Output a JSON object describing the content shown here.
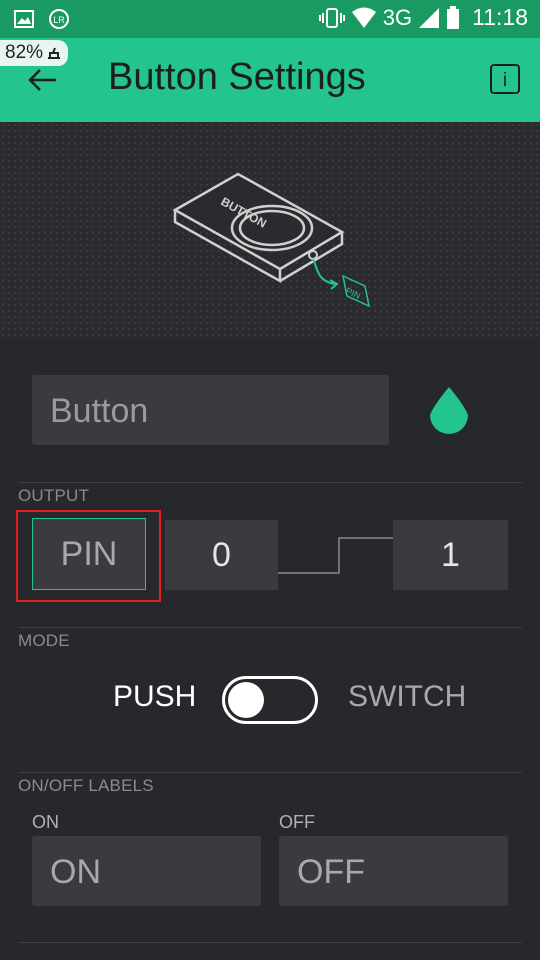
{
  "status_bar": {
    "network": "3G",
    "time": "11:18",
    "battery": "82%"
  },
  "header": {
    "title": "Button Settings",
    "info_label": "i"
  },
  "hero": {
    "device_label": "BUTTON",
    "pin_tag": "PIN"
  },
  "widget": {
    "name_value": "Button",
    "accent_color": "#23c48e"
  },
  "output": {
    "section_label": "OUTPUT",
    "pin_label": "PIN",
    "low_value": "0",
    "high_value": "1"
  },
  "mode": {
    "section_label": "MODE",
    "push_label": "PUSH",
    "switch_label": "SWITCH",
    "selected": "PUSH"
  },
  "labels": {
    "section_label": "ON/OFF LABELS",
    "on_caption": "ON",
    "off_caption": "OFF",
    "on_value": "ON",
    "off_value": "OFF"
  }
}
